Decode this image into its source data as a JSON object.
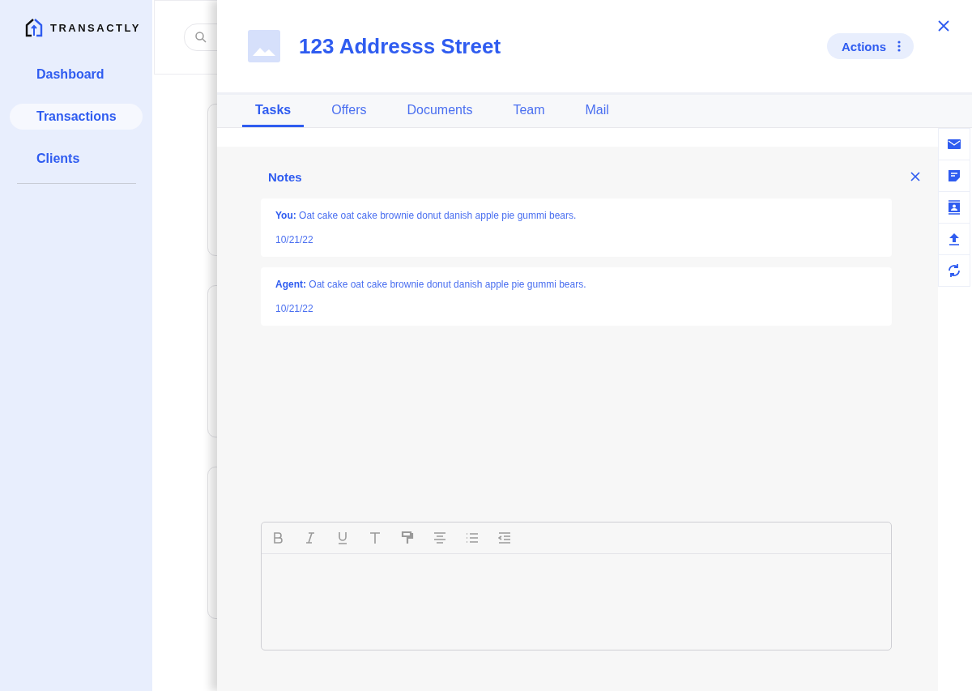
{
  "brand": {
    "name": "TRANSACTLY"
  },
  "sidebar": {
    "items": [
      {
        "label": "Dashboard",
        "selected": false
      },
      {
        "label": "Transactions",
        "selected": true
      },
      {
        "label": "Clients",
        "selected": false
      }
    ]
  },
  "drawer": {
    "title": "123 Addresss Street",
    "actions_button": "Actions",
    "tabs": [
      {
        "label": "Tasks",
        "selected": true
      },
      {
        "label": "Offers",
        "selected": false
      },
      {
        "label": "Documents",
        "selected": false
      },
      {
        "label": "Team",
        "selected": false
      },
      {
        "label": "Mail",
        "selected": false
      }
    ],
    "notes": {
      "title": "Notes",
      "items": [
        {
          "author": "You:",
          "text": "Oat cake oat cake brownie donut danish apple pie gummi bears.",
          "date": "10/21/22"
        },
        {
          "author": "Agent:",
          "text": "Oat cake oat cake brownie donut danish apple pie gummi bears.",
          "date": "10/21/22"
        }
      ]
    },
    "rail": [
      {
        "kind": "mail"
      },
      {
        "kind": "note"
      },
      {
        "kind": "contact"
      },
      {
        "kind": "upload"
      },
      {
        "kind": "sync"
      }
    ],
    "editor_tools": [
      {
        "kind": "bold"
      },
      {
        "kind": "italic"
      },
      {
        "kind": "underline"
      },
      {
        "kind": "text"
      },
      {
        "kind": "paint"
      },
      {
        "kind": "align"
      },
      {
        "kind": "list"
      },
      {
        "kind": "indent"
      }
    ]
  }
}
